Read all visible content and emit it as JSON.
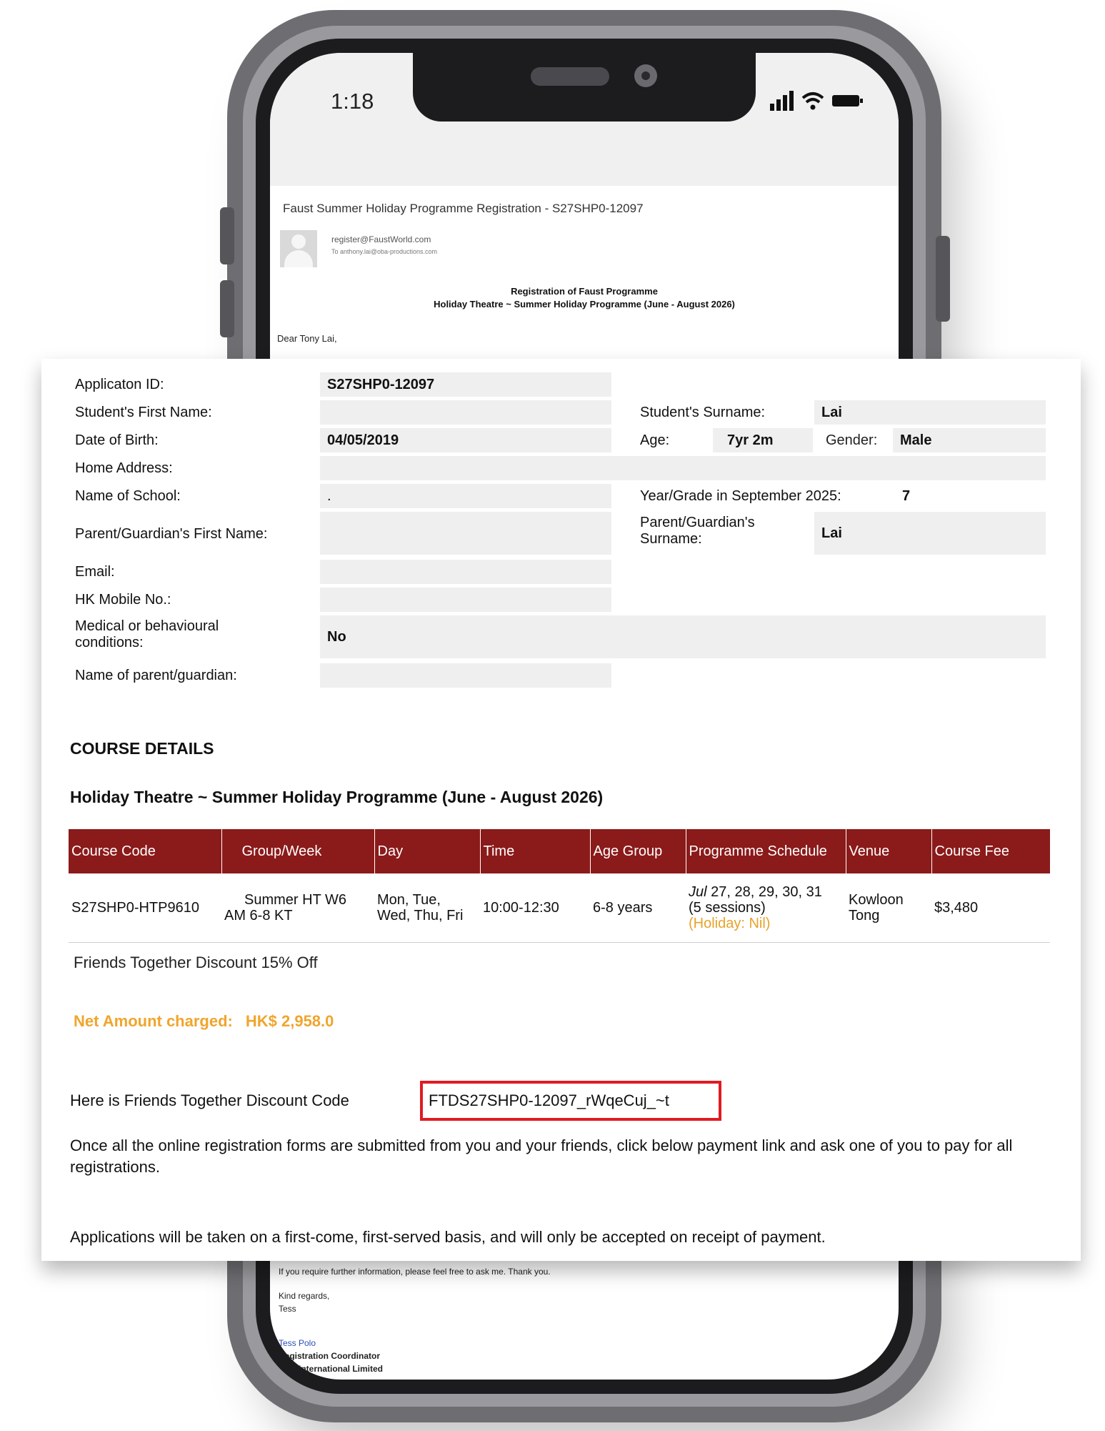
{
  "status_bar": {
    "time": "1:18"
  },
  "email": {
    "subject": "Faust Summer Holiday Programme Registration - S27SHP0-12097",
    "from": "register@FaustWorld.com",
    "to": "To  anthony.lai@oba-productions.com",
    "title_line1": "Registration of Faust Programme",
    "title_line2": "Holiday Theatre ~ Summer Holiday Programme (June - August 2026)",
    "greeting": "Dear Tony Lai,",
    "further_info": "If you require further information, please feel free to ask me. Thank you.",
    "regards": "Kind regards,",
    "sender_short": "Tess",
    "sender_name": "Tess Polo",
    "sender_role": "Registration Coordinator",
    "sender_company": "International Limited"
  },
  "form": {
    "application_id_label": "Applicaton ID:",
    "application_id": "S27SHP0-12097",
    "first_name_label": "Student's First Name:",
    "first_name": "",
    "surname_label": "Student's Surname:",
    "surname": "Lai",
    "dob_label": "Date of Birth:",
    "dob": "04/05/2019",
    "age_label": "Age:",
    "age": "7yr 2m",
    "gender_label": "Gender:",
    "gender": "Male",
    "address_label": "Home Address:",
    "address": "",
    "school_label": "Name of School:",
    "school": ".",
    "year_label": "Year/Grade in September 2025:",
    "year": "7",
    "parent_first_label": "Parent/Guardian's First Name:",
    "parent_first": "",
    "parent_surname_label": "Parent/Guardian's Surname:",
    "parent_surname": "Lai",
    "email_label": "Email:",
    "email": "",
    "mobile_label": "HK Mobile No.:",
    "mobile": "",
    "medical_label": "Medical or behavioural conditions:",
    "medical": "No",
    "guardian_label": "Name of parent/guardian:",
    "guardian": ""
  },
  "course": {
    "section_title": "COURSE DETAILS",
    "programme_title": "Holiday Theatre ~ Summer Holiday Programme (June - August 2026)",
    "headers": [
      "Course Code",
      "Group/Week",
      "Day",
      "Time",
      "Age Group",
      "Programme Schedule",
      "Venue",
      "Course Fee"
    ],
    "row": {
      "code": "S27SHP0-HTP9610",
      "group_a": "Summer HT W6",
      "group_b": "AM 6-8 KT",
      "day_a": "Mon, Tue,",
      "day_b": "Wed, Thu, Fri",
      "time": "10:00-12:30",
      "age_group": "6-8 years",
      "schedule_month": "Jul",
      "schedule_days": " 27, 28, 29, 30, 31",
      "schedule_sessions": "(5 sessions)",
      "schedule_holiday": "(Holiday: Nil)",
      "venue_a": "Kowloon",
      "venue_b": "Tong",
      "fee": "$3,480"
    }
  },
  "discount": {
    "line": "Friends Together Discount 15% Off",
    "net_label": "Net Amount charged:",
    "net_value": "HK$ 2,958.0",
    "code_intro": "Here is Friends Together Discount Code",
    "code": "FTDS27SHP0-12097_rWqeCuj_~t",
    "para1": "Once all the online registration forms are submitted from you and your friends, click below payment link and ask one of you to pay for all registrations.",
    "para2": "Applications will be taken on a first-come, first-served basis, and will only be accepted on receipt of payment."
  },
  "colors": {
    "table_header": "#8b1a1a",
    "net_amount": "#f0a52c",
    "highlight_box": "#e01b22"
  }
}
